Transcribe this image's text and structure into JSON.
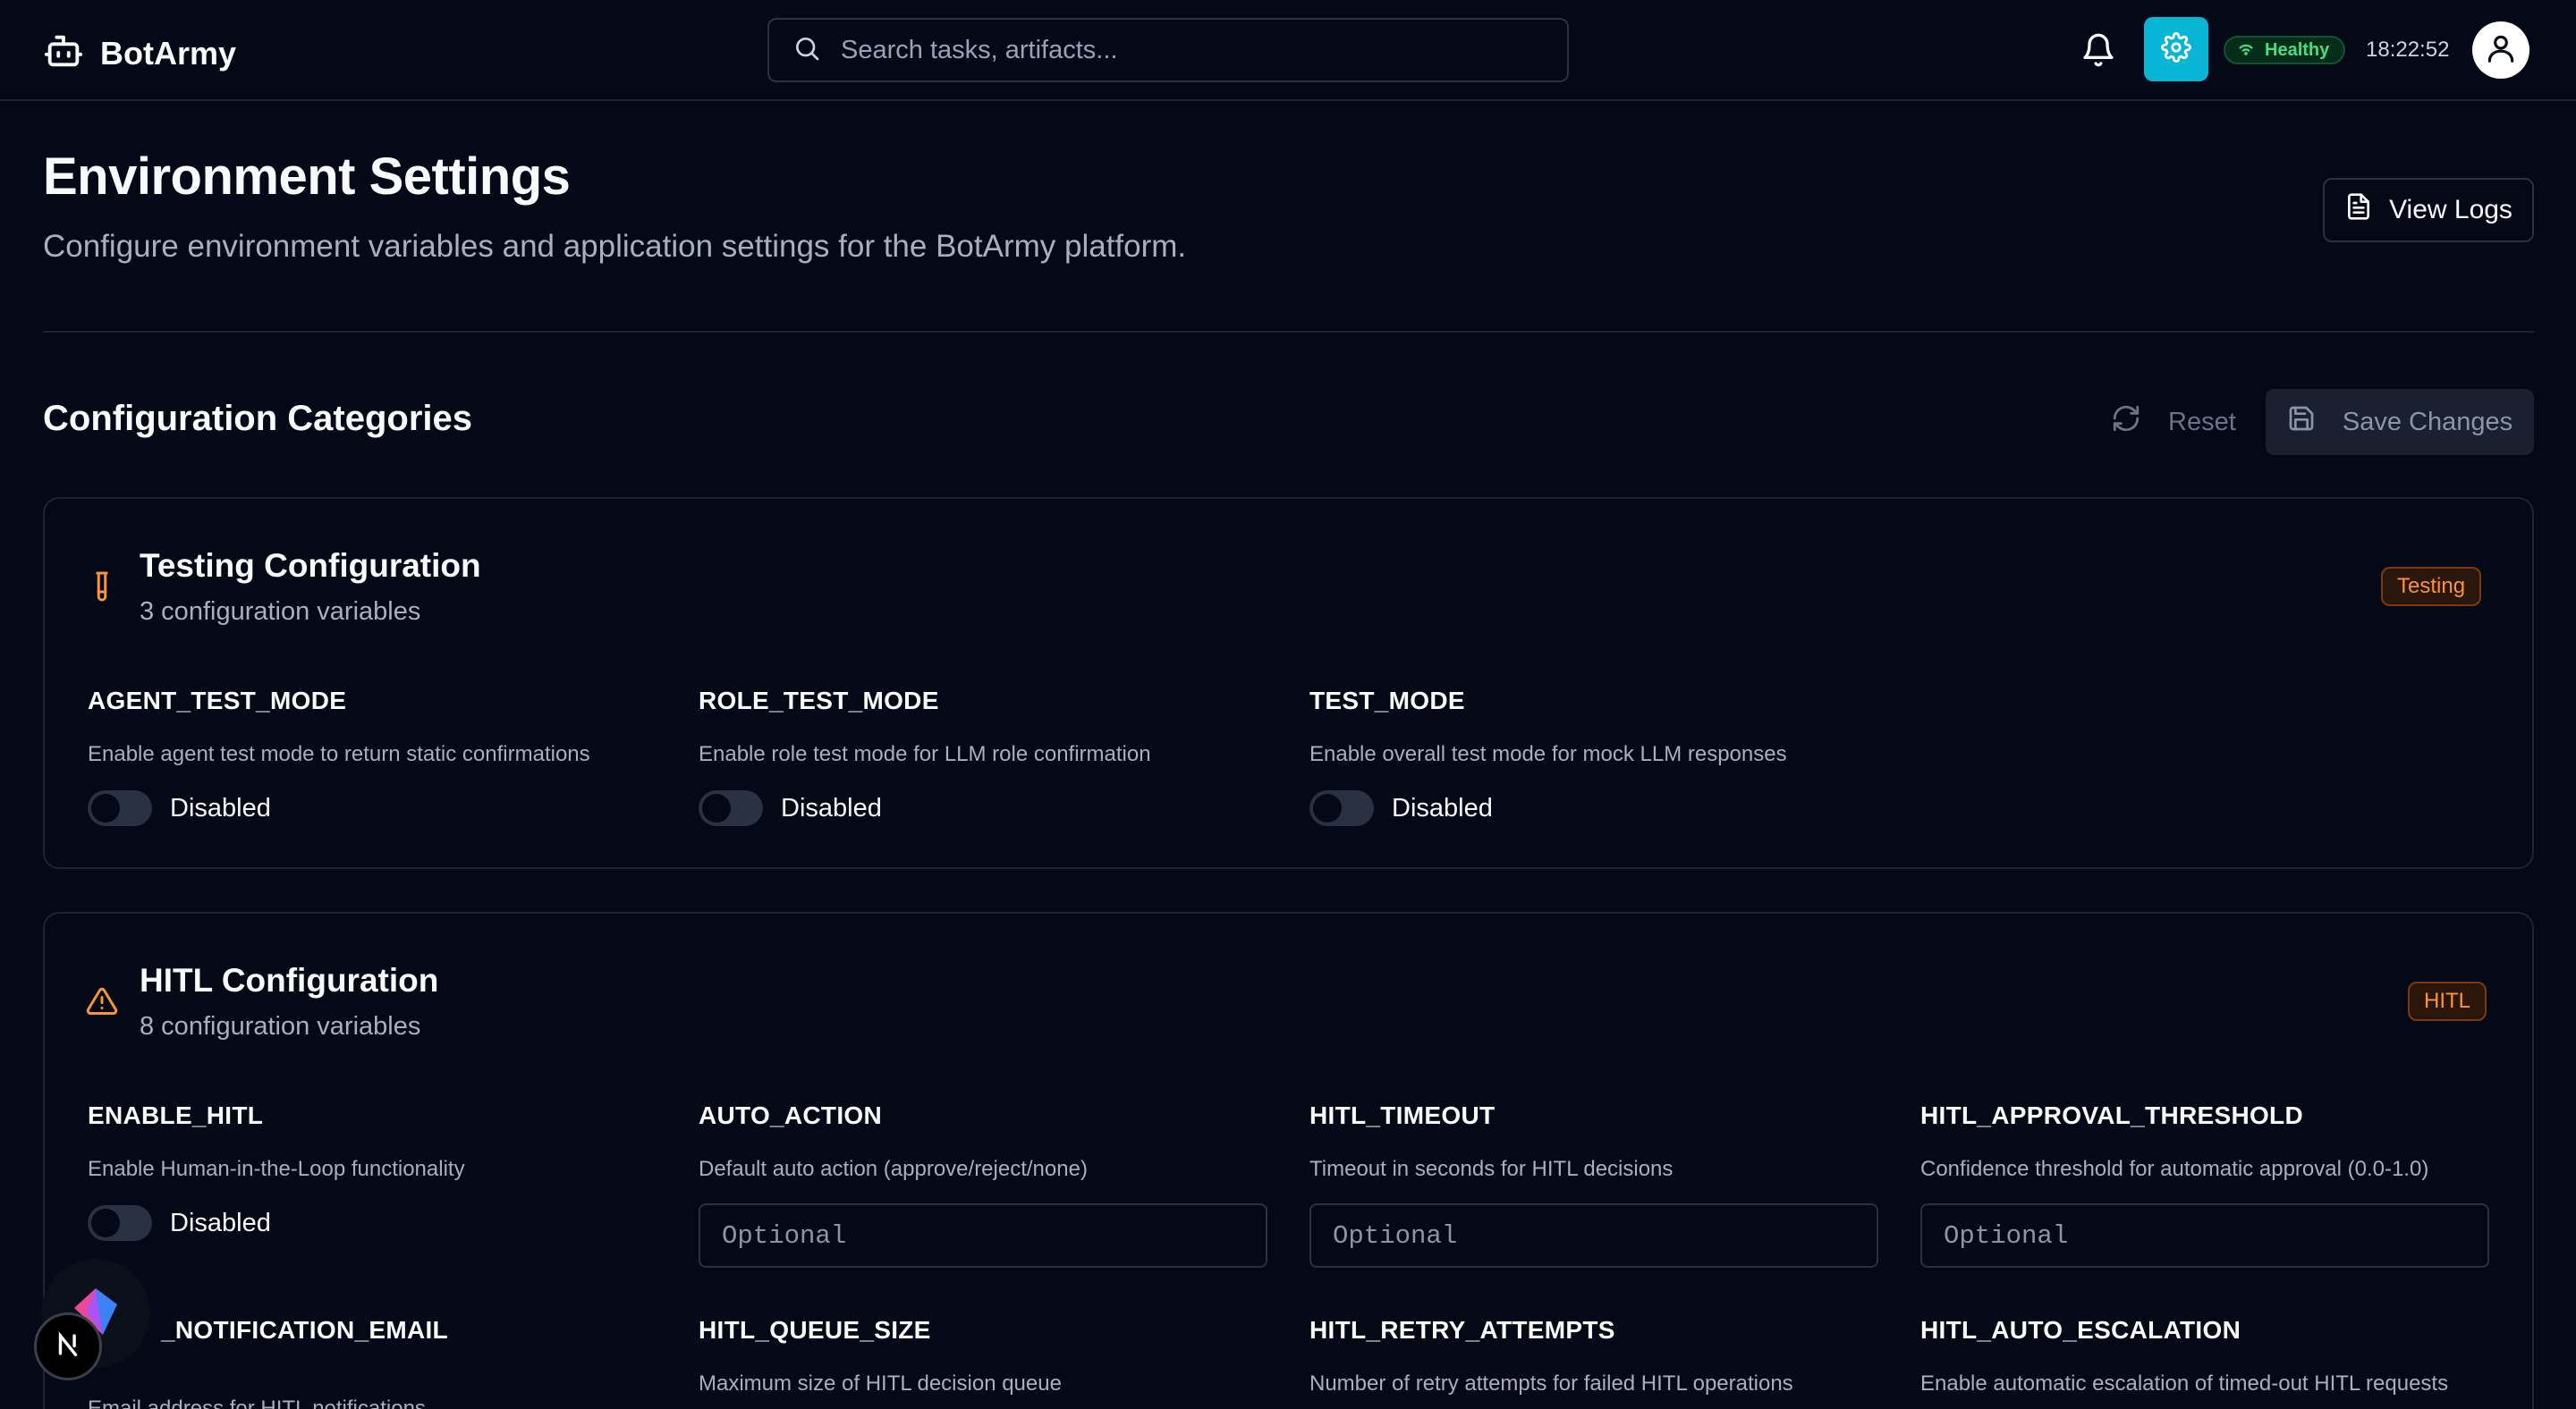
{
  "app": {
    "name": "BotArmy"
  },
  "search": {
    "placeholder": "Search tasks, artifacts..."
  },
  "status": {
    "health": "Healthy",
    "time": "18:22:52"
  },
  "page": {
    "title": "Environment Settings",
    "subtitle": "Configure environment variables and application settings for the BotArmy platform.",
    "view_logs": "View Logs"
  },
  "section": {
    "title": "Configuration Categories",
    "reset": "Reset",
    "save": "Save Changes"
  },
  "cards": {
    "testing": {
      "title": "Testing Configuration",
      "count": "3 configuration variables",
      "tag": "Testing",
      "fields": [
        {
          "name": "AGENT_TEST_MODE",
          "desc": "Enable agent test mode to return static confirmations",
          "type": "toggle",
          "value": "Disabled"
        },
        {
          "name": "ROLE_TEST_MODE",
          "desc": "Enable role test mode for LLM role confirmation",
          "type": "toggle",
          "value": "Disabled"
        },
        {
          "name": "TEST_MODE",
          "desc": "Enable overall test mode for mock LLM responses",
          "type": "toggle",
          "value": "Disabled"
        }
      ]
    },
    "hitl": {
      "title": "HITL Configuration",
      "count": "8 configuration variables",
      "tag": "HITL",
      "fields": [
        {
          "name": "ENABLE_HITL",
          "desc": "Enable Human-in-the-Loop functionality",
          "type": "toggle",
          "value": "Disabled"
        },
        {
          "name": "AUTO_ACTION",
          "desc": "Default auto action (approve/reject/none)",
          "type": "input",
          "placeholder": "Optional"
        },
        {
          "name": "HITL_TIMEOUT",
          "desc": "Timeout in seconds for HITL decisions",
          "type": "input",
          "placeholder": "Optional"
        },
        {
          "name": "HITL_APPROVAL_THRESHOLD",
          "desc": "Confidence threshold for automatic approval (0.0-1.0)",
          "type": "input",
          "placeholder": "Optional"
        },
        {
          "name": "_NOTIFICATION_EMAIL",
          "desc": "Email address for HITL notifications"
        },
        {
          "name": "HITL_QUEUE_SIZE",
          "desc": "Maximum size of HITL decision queue"
        },
        {
          "name": "HITL_RETRY_ATTEMPTS",
          "desc": "Number of retry attempts for failed HITL operations"
        },
        {
          "name": "HITL_AUTO_ESCALATION",
          "desc": "Enable automatic escalation of timed-out HITL requests"
        }
      ]
    }
  },
  "colors": {
    "background": "#050816",
    "accent": "#06b6d4",
    "healthy": "#4ade80",
    "warning": "#fb923c"
  },
  "icons": [
    "bot-icon",
    "search-icon",
    "bell-icon",
    "gear-icon",
    "wifi-icon",
    "user-icon",
    "file-text-icon",
    "refresh-icon",
    "save-icon",
    "test-tube-icon",
    "alert-triangle-icon"
  ]
}
